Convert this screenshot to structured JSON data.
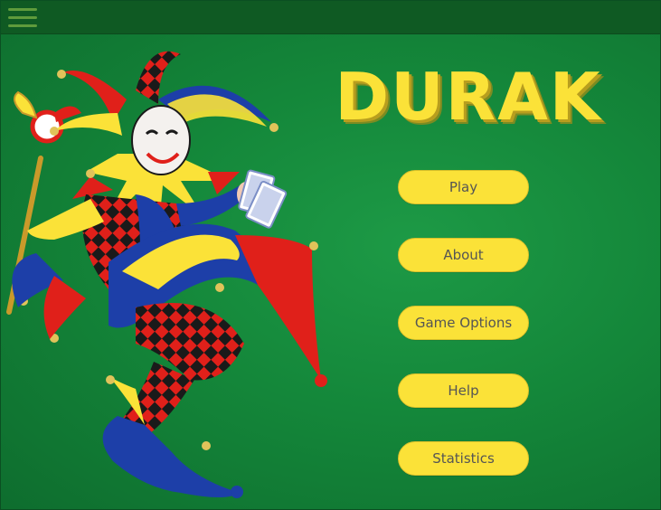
{
  "header": {
    "menu_icon": "hamburger-menu-icon"
  },
  "title": "DURAK",
  "menu": {
    "buttons": [
      {
        "label": "Play"
      },
      {
        "label": "About"
      },
      {
        "label": "Game Options"
      },
      {
        "label": "Help"
      },
      {
        "label": "Statistics"
      }
    ]
  },
  "illustration": {
    "subject": "jester-illustration"
  },
  "colors": {
    "background": "#14873a",
    "topbar": "#0f5a23",
    "accent": "#fbe238",
    "button_text": "#555555"
  }
}
